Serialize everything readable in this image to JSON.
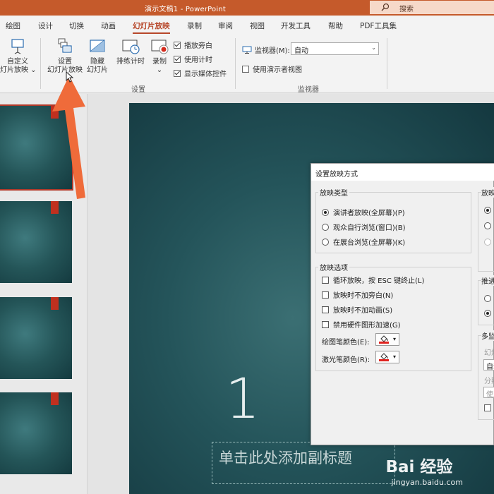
{
  "titlebar": {
    "title": "演示文稿1  -  PowerPoint",
    "search_placeholder": "搜索",
    "accent": "#c55a2b"
  },
  "tabs": [
    {
      "label": "绘图",
      "active": false
    },
    {
      "label": "设计",
      "active": false
    },
    {
      "label": "切换",
      "active": false
    },
    {
      "label": "动画",
      "active": false
    },
    {
      "label": "幻灯片放映",
      "active": true
    },
    {
      "label": "录制",
      "active": false
    },
    {
      "label": "审阅",
      "active": false
    },
    {
      "label": "视图",
      "active": false
    },
    {
      "label": "开发工具",
      "active": false
    },
    {
      "label": "帮助",
      "active": false
    },
    {
      "label": "PDF工具集",
      "active": false
    }
  ],
  "ribbon": {
    "custom_show": {
      "line1": "自定义",
      "line2": "灯片放映 ⌄"
    },
    "setup_show": {
      "line1": "设置",
      "line2": "幻灯片放映"
    },
    "hide_slide": {
      "line1": "隐藏",
      "line2": "幻灯片"
    },
    "rehearse": {
      "label": "排练计时"
    },
    "record": {
      "line1": "录制",
      "line2": "⌄"
    },
    "checks": [
      {
        "label": "播放旁白",
        "checked": true
      },
      {
        "label": "使用计时",
        "checked": true
      },
      {
        "label": "显示媒体控件",
        "checked": true
      }
    ],
    "setup_group_label": "设置",
    "monitor_label": "监视器(M):",
    "monitor_value": "自动",
    "presenter_view_label": "使用演示者视图",
    "presenter_view_checked": false,
    "monitor_group_label": "监视器"
  },
  "slide": {
    "number_text": "1",
    "subtitle_placeholder": "单击此处添加副标题"
  },
  "dialog": {
    "title": "设置放映方式",
    "show_type": {
      "legend": "放映类型",
      "options": [
        {
          "label": "演讲者放映(全屏幕)(P)",
          "selected": true
        },
        {
          "label": "观众自行浏览(窗口)(B)",
          "selected": false
        },
        {
          "label": "在展台浏览(全屏幕)(K)",
          "selected": false
        }
      ]
    },
    "show_options": {
      "legend": "放映选项",
      "items": [
        {
          "label": "循环放映，按 ESC 键终止(L)",
          "checked": false
        },
        {
          "label": "放映时不加旁白(N)",
          "checked": false
        },
        {
          "label": "放映时不加动画(S)",
          "checked": false
        },
        {
          "label": "禁用硬件图形加速(G)",
          "checked": false
        }
      ],
      "pen_color_label": "绘图笔颜色(E):",
      "laser_color_label": "激光笔颜色(R):",
      "pen_color": "#e0231f"
    },
    "right_fragments": {
      "slides_legend": "放映",
      "advance_legend": "推进",
      "multi_monitor_legend": "多监",
      "slideshow_monitor_label": "幻灯",
      "monitor_box_value": "自动",
      "resolution_label": "分辨",
      "resolution_box_value": "使用"
    }
  },
  "watermark": {
    "main": "Bai  经验",
    "url": "jingyan.baidu.com"
  }
}
